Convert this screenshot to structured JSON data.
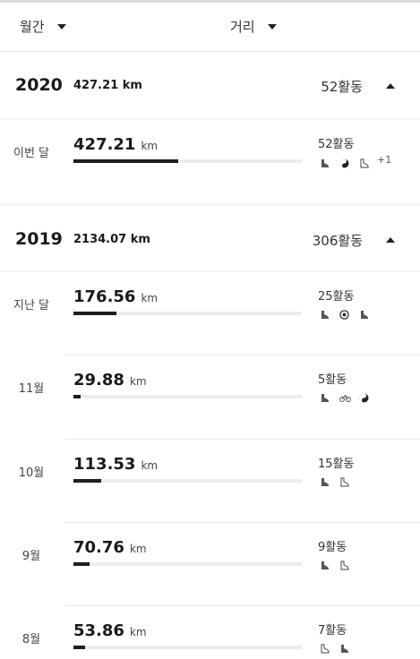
{
  "filters": {
    "period_label": "월간",
    "metric_label": "거리"
  },
  "years": [
    {
      "year": "2020",
      "distance": "427.21 km",
      "activities": "52활동",
      "months": [
        {
          "label": "이번 달",
          "distance": "427.21",
          "unit": "km",
          "activities": "52활동",
          "progress": 0.46,
          "icons": [
            "shoe-icon",
            "yin-yang-icon",
            "shoe-outline-icon"
          ],
          "more": "+1"
        }
      ]
    },
    {
      "year": "2019",
      "distance": "2134.07 km",
      "activities": "306활동",
      "months": [
        {
          "label": "지난 달",
          "distance": "176.56",
          "unit": "km",
          "activities": "25활동",
          "progress": 0.19,
          "icons": [
            "shoe-icon",
            "target-icon",
            "shoe-icon"
          ],
          "more": ""
        },
        {
          "label": "11월",
          "distance": "29.88",
          "unit": "km",
          "activities": "5활동",
          "progress": 0.03,
          "icons": [
            "shoe-icon",
            "bike-icon",
            "yin-yang-icon"
          ],
          "more": ""
        },
        {
          "label": "10월",
          "distance": "113.53",
          "unit": "km",
          "activities": "15활동",
          "progress": 0.12,
          "icons": [
            "shoe-icon",
            "shoe-outline-icon"
          ],
          "more": ""
        },
        {
          "label": "9월",
          "distance": "70.76",
          "unit": "km",
          "activities": "9활동",
          "progress": 0.07,
          "icons": [
            "shoe-icon",
            "shoe-outline-icon"
          ],
          "more": ""
        },
        {
          "label": "8월",
          "distance": "53.86",
          "unit": "km",
          "activities": "7활동",
          "progress": 0.05,
          "icons": [
            "shoe-outline-icon",
            "shoe-icon"
          ],
          "more": ""
        }
      ]
    }
  ],
  "colors": {
    "bar_fill": "#1e1e1e",
    "bar_track": "#ececec",
    "section_gap": "#f5f5f5"
  }
}
